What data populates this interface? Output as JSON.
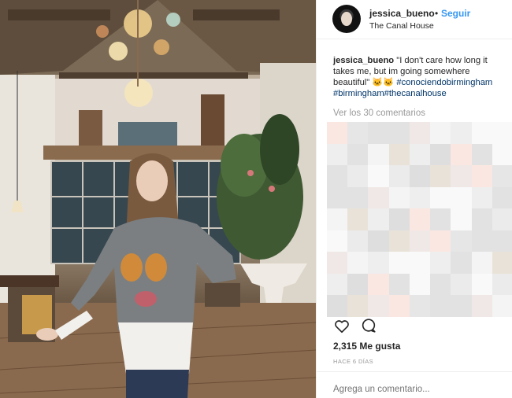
{
  "post": {
    "username": "jessica_bueno",
    "separator": "•",
    "follow_label": "Seguir",
    "location": "The Canal House",
    "caption": {
      "user": "jessica_bueno",
      "text": " \"I don't care how long it takes me, but im going somewhere beautiful\" 🐱🐱 ",
      "tags": [
        "#conociendobirmingham",
        "#birmingham",
        "#thecanalhouse"
      ]
    },
    "view_comments": "Ver los 30 comentarios",
    "likes": "2,315 Me gusta",
    "time_ago": "HACE 6 DÍAS",
    "add_comment_placeholder": "Agrega un comentario..."
  },
  "colors": {
    "link_blue": "#3897f0",
    "hashtag": "#003569",
    "muted": "#999999",
    "text": "#262626",
    "divider": "#efefef"
  },
  "icons": {
    "like": "heart-icon",
    "comment": "speech-bubble-icon"
  }
}
